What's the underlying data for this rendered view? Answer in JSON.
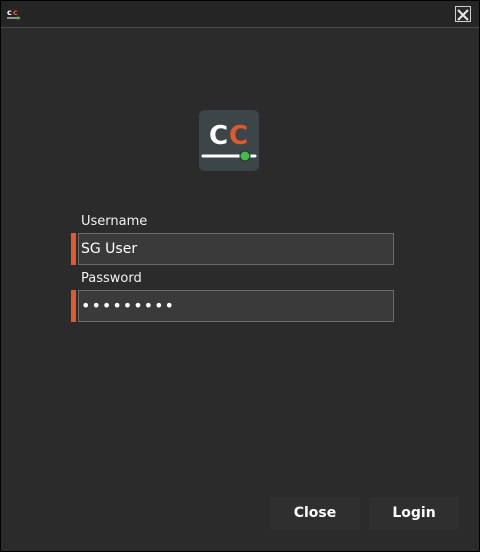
{
  "titlebar": {
    "app_icon": "cc-app-icon",
    "close_icon": "close-icon"
  },
  "logo": {
    "text_left": "C",
    "text_right": "C",
    "colors": {
      "tile": "#3c4648",
      "left_c": "#ffffff",
      "right_c": "#e25a2c",
      "slider_dot": "#3fbf4a"
    }
  },
  "form": {
    "username": {
      "label": "Username",
      "value": "SG User"
    },
    "password": {
      "label": "Password",
      "value": "•••••••••"
    },
    "accent_color": "#e25a2c"
  },
  "buttons": {
    "close_label": "Close",
    "login_label": "Login"
  }
}
